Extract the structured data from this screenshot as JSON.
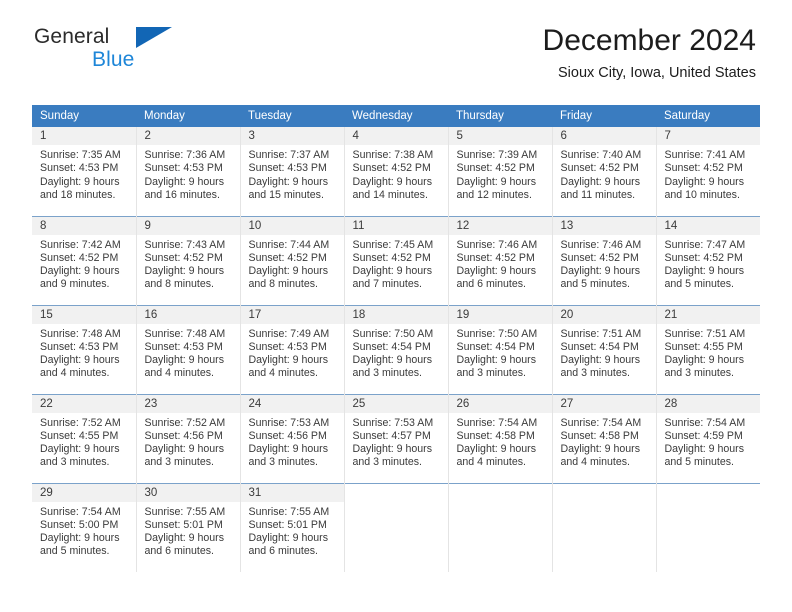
{
  "brand": {
    "name_top": "General",
    "name_bottom": "Blue",
    "triangle_color": "#1266b5",
    "text_color_bottom": "#1e86d8"
  },
  "header": {
    "title": "December 2024",
    "location": "Sioux City, Iowa, United States"
  },
  "theme": {
    "header_bg": "#3a7cc0",
    "header_text": "#ffffff",
    "daynum_bg": "#f1f1f1",
    "row_rule": "#7ba2ca",
    "cell_text": "#3a3a3a"
  },
  "weekdays": [
    "Sunday",
    "Monday",
    "Tuesday",
    "Wednesday",
    "Thursday",
    "Friday",
    "Saturday"
  ],
  "weeks": [
    [
      {
        "day": "1",
        "sunrise": "Sunrise: 7:35 AM",
        "sunset": "Sunset: 4:53 PM",
        "daylight1": "Daylight: 9 hours",
        "daylight2": "and 18 minutes."
      },
      {
        "day": "2",
        "sunrise": "Sunrise: 7:36 AM",
        "sunset": "Sunset: 4:53 PM",
        "daylight1": "Daylight: 9 hours",
        "daylight2": "and 16 minutes."
      },
      {
        "day": "3",
        "sunrise": "Sunrise: 7:37 AM",
        "sunset": "Sunset: 4:53 PM",
        "daylight1": "Daylight: 9 hours",
        "daylight2": "and 15 minutes."
      },
      {
        "day": "4",
        "sunrise": "Sunrise: 7:38 AM",
        "sunset": "Sunset: 4:52 PM",
        "daylight1": "Daylight: 9 hours",
        "daylight2": "and 14 minutes."
      },
      {
        "day": "5",
        "sunrise": "Sunrise: 7:39 AM",
        "sunset": "Sunset: 4:52 PM",
        "daylight1": "Daylight: 9 hours",
        "daylight2": "and 12 minutes."
      },
      {
        "day": "6",
        "sunrise": "Sunrise: 7:40 AM",
        "sunset": "Sunset: 4:52 PM",
        "daylight1": "Daylight: 9 hours",
        "daylight2": "and 11 minutes."
      },
      {
        "day": "7",
        "sunrise": "Sunrise: 7:41 AM",
        "sunset": "Sunset: 4:52 PM",
        "daylight1": "Daylight: 9 hours",
        "daylight2": "and 10 minutes."
      }
    ],
    [
      {
        "day": "8",
        "sunrise": "Sunrise: 7:42 AM",
        "sunset": "Sunset: 4:52 PM",
        "daylight1": "Daylight: 9 hours",
        "daylight2": "and 9 minutes."
      },
      {
        "day": "9",
        "sunrise": "Sunrise: 7:43 AM",
        "sunset": "Sunset: 4:52 PM",
        "daylight1": "Daylight: 9 hours",
        "daylight2": "and 8 minutes."
      },
      {
        "day": "10",
        "sunrise": "Sunrise: 7:44 AM",
        "sunset": "Sunset: 4:52 PM",
        "daylight1": "Daylight: 9 hours",
        "daylight2": "and 8 minutes."
      },
      {
        "day": "11",
        "sunrise": "Sunrise: 7:45 AM",
        "sunset": "Sunset: 4:52 PM",
        "daylight1": "Daylight: 9 hours",
        "daylight2": "and 7 minutes."
      },
      {
        "day": "12",
        "sunrise": "Sunrise: 7:46 AM",
        "sunset": "Sunset: 4:52 PM",
        "daylight1": "Daylight: 9 hours",
        "daylight2": "and 6 minutes."
      },
      {
        "day": "13",
        "sunrise": "Sunrise: 7:46 AM",
        "sunset": "Sunset: 4:52 PM",
        "daylight1": "Daylight: 9 hours",
        "daylight2": "and 5 minutes."
      },
      {
        "day": "14",
        "sunrise": "Sunrise: 7:47 AM",
        "sunset": "Sunset: 4:52 PM",
        "daylight1": "Daylight: 9 hours",
        "daylight2": "and 5 minutes."
      }
    ],
    [
      {
        "day": "15",
        "sunrise": "Sunrise: 7:48 AM",
        "sunset": "Sunset: 4:53 PM",
        "daylight1": "Daylight: 9 hours",
        "daylight2": "and 4 minutes."
      },
      {
        "day": "16",
        "sunrise": "Sunrise: 7:48 AM",
        "sunset": "Sunset: 4:53 PM",
        "daylight1": "Daylight: 9 hours",
        "daylight2": "and 4 minutes."
      },
      {
        "day": "17",
        "sunrise": "Sunrise: 7:49 AM",
        "sunset": "Sunset: 4:53 PM",
        "daylight1": "Daylight: 9 hours",
        "daylight2": "and 4 minutes."
      },
      {
        "day": "18",
        "sunrise": "Sunrise: 7:50 AM",
        "sunset": "Sunset: 4:54 PM",
        "daylight1": "Daylight: 9 hours",
        "daylight2": "and 3 minutes."
      },
      {
        "day": "19",
        "sunrise": "Sunrise: 7:50 AM",
        "sunset": "Sunset: 4:54 PM",
        "daylight1": "Daylight: 9 hours",
        "daylight2": "and 3 minutes."
      },
      {
        "day": "20",
        "sunrise": "Sunrise: 7:51 AM",
        "sunset": "Sunset: 4:54 PM",
        "daylight1": "Daylight: 9 hours",
        "daylight2": "and 3 minutes."
      },
      {
        "day": "21",
        "sunrise": "Sunrise: 7:51 AM",
        "sunset": "Sunset: 4:55 PM",
        "daylight1": "Daylight: 9 hours",
        "daylight2": "and 3 minutes."
      }
    ],
    [
      {
        "day": "22",
        "sunrise": "Sunrise: 7:52 AM",
        "sunset": "Sunset: 4:55 PM",
        "daylight1": "Daylight: 9 hours",
        "daylight2": "and 3 minutes."
      },
      {
        "day": "23",
        "sunrise": "Sunrise: 7:52 AM",
        "sunset": "Sunset: 4:56 PM",
        "daylight1": "Daylight: 9 hours",
        "daylight2": "and 3 minutes."
      },
      {
        "day": "24",
        "sunrise": "Sunrise: 7:53 AM",
        "sunset": "Sunset: 4:56 PM",
        "daylight1": "Daylight: 9 hours",
        "daylight2": "and 3 minutes."
      },
      {
        "day": "25",
        "sunrise": "Sunrise: 7:53 AM",
        "sunset": "Sunset: 4:57 PM",
        "daylight1": "Daylight: 9 hours",
        "daylight2": "and 3 minutes."
      },
      {
        "day": "26",
        "sunrise": "Sunrise: 7:54 AM",
        "sunset": "Sunset: 4:58 PM",
        "daylight1": "Daylight: 9 hours",
        "daylight2": "and 4 minutes."
      },
      {
        "day": "27",
        "sunrise": "Sunrise: 7:54 AM",
        "sunset": "Sunset: 4:58 PM",
        "daylight1": "Daylight: 9 hours",
        "daylight2": "and 4 minutes."
      },
      {
        "day": "28",
        "sunrise": "Sunrise: 7:54 AM",
        "sunset": "Sunset: 4:59 PM",
        "daylight1": "Daylight: 9 hours",
        "daylight2": "and 5 minutes."
      }
    ],
    [
      {
        "day": "29",
        "sunrise": "Sunrise: 7:54 AM",
        "sunset": "Sunset: 5:00 PM",
        "daylight1": "Daylight: 9 hours",
        "daylight2": "and 5 minutes."
      },
      {
        "day": "30",
        "sunrise": "Sunrise: 7:55 AM",
        "sunset": "Sunset: 5:01 PM",
        "daylight1": "Daylight: 9 hours",
        "daylight2": "and 6 minutes."
      },
      {
        "day": "31",
        "sunrise": "Sunrise: 7:55 AM",
        "sunset": "Sunset: 5:01 PM",
        "daylight1": "Daylight: 9 hours",
        "daylight2": "and 6 minutes."
      },
      {
        "day": "",
        "sunrise": "",
        "sunset": "",
        "daylight1": "",
        "daylight2": ""
      },
      {
        "day": "",
        "sunrise": "",
        "sunset": "",
        "daylight1": "",
        "daylight2": ""
      },
      {
        "day": "",
        "sunrise": "",
        "sunset": "",
        "daylight1": "",
        "daylight2": ""
      },
      {
        "day": "",
        "sunrise": "",
        "sunset": "",
        "daylight1": "",
        "daylight2": ""
      }
    ]
  ]
}
